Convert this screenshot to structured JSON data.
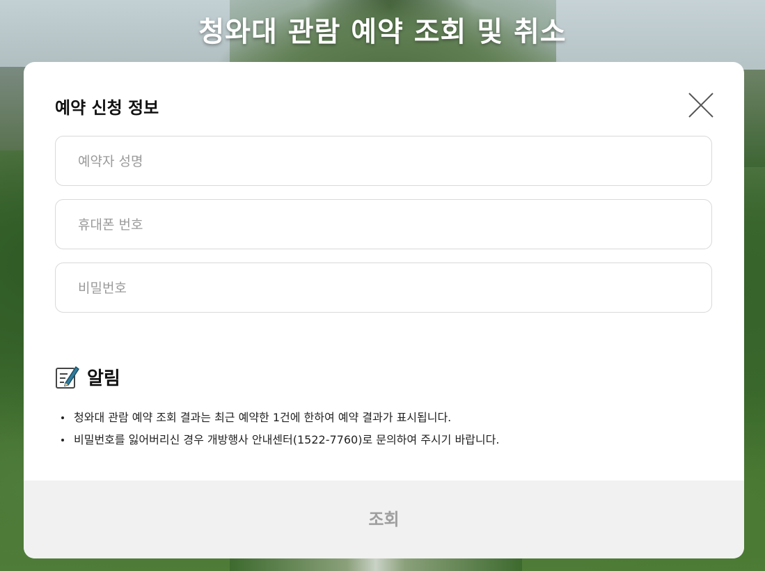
{
  "page": {
    "title": "청와대 관람 예약 조회 및 취소"
  },
  "modal": {
    "title": "예약 신청 정보",
    "close_icon": "close-x-icon",
    "fields": {
      "name_placeholder": "예약자 성명",
      "phone_placeholder": "휴대폰 번호",
      "password_placeholder": "비밀번호"
    },
    "notice": {
      "icon": "memo-pencil-icon",
      "title": "알림",
      "items": [
        "청와대 관람 예약 조회 결과는 최근 예약한 1건에 한하여 예약 결과가 표시됩니다.",
        "비밀번호를 잃어버리신 경우 개방행사 안내센터(1522-7760)로 문의하여 주시기 바랍니다."
      ]
    },
    "submit_label": "조회"
  },
  "colors": {
    "modal_bg": "#ffffff",
    "submit_bg": "#f1f1f1",
    "submit_text": "#9e9e9e",
    "field_border": "#d9d9d9",
    "placeholder": "#9a9a9a",
    "notice_icon_accent": "#2f7d9e"
  }
}
